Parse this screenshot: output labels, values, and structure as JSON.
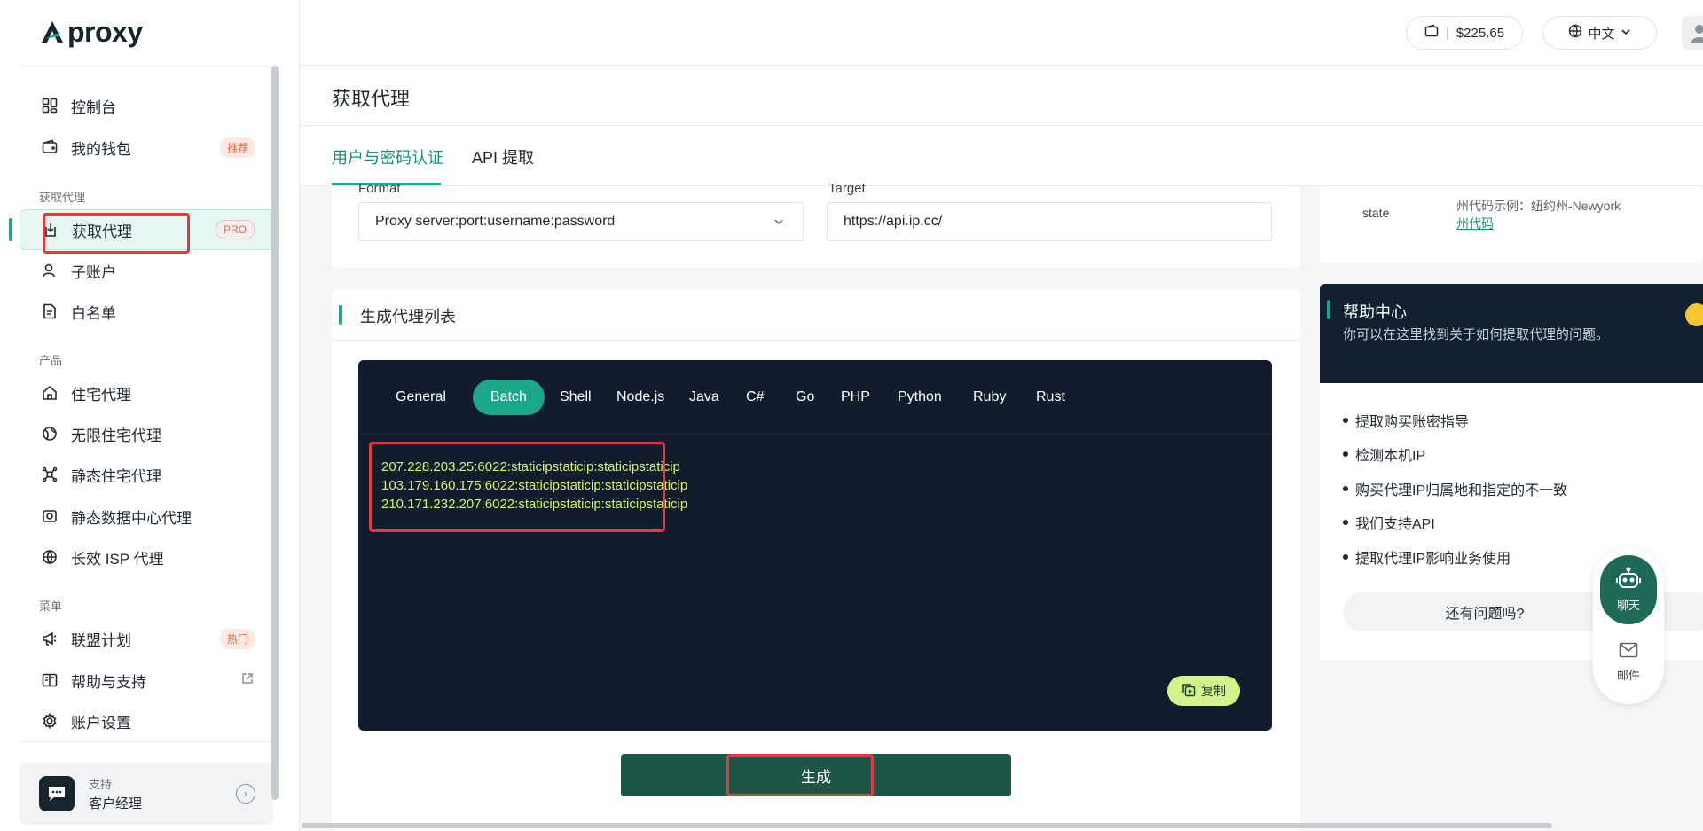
{
  "app": {
    "logo_text": "proxy"
  },
  "sidebar": {
    "sections": {
      "proxy": "获取代理",
      "product": "产品",
      "menu": "菜单"
    },
    "items": [
      {
        "label": "控制台"
      },
      {
        "label": "我的钱包",
        "badge": "推荐"
      },
      {
        "label": "获取代理",
        "badge": "PRO"
      },
      {
        "label": "子账户"
      },
      {
        "label": "白名单"
      },
      {
        "label": "住宅代理"
      },
      {
        "label": "无限住宅代理"
      },
      {
        "label": "静态住宅代理"
      },
      {
        "label": "静态数据中心代理"
      },
      {
        "label": "长效 ISP 代理"
      },
      {
        "label": "联盟计划",
        "badge": "热门"
      },
      {
        "label": "帮助与支持"
      },
      {
        "label": "账户设置"
      }
    ],
    "support": {
      "label": "支持",
      "name": "客户经理"
    }
  },
  "topbar": {
    "balance": "$225.65",
    "language": "中文"
  },
  "page": {
    "title": "获取代理",
    "tabs": [
      "用户与密码认证",
      "API 提取"
    ]
  },
  "form": {
    "format_label": "Format",
    "format_value": "Proxy server:port:username:password",
    "target_label": "Target",
    "target_value": "https://api.ip.cc/"
  },
  "proxy_list": {
    "title": "生成代理列表",
    "code_tabs": [
      "General",
      "Batch",
      "Shell",
      "Node.js",
      "Java",
      "C#",
      "Go",
      "PHP",
      "Python",
      "Ruby",
      "Rust"
    ],
    "active_tab": "Batch",
    "lines": [
      "207.228.203.25:6022:staticipstaticip:staticipstaticip",
      "103.179.160.175:6022:staticipstaticip:staticipstaticip",
      "210.171.232.207:6022:staticipstaticip:staticipstaticip"
    ],
    "copy_label": "复制",
    "generate_label": "生成"
  },
  "state_info": {
    "label": "state",
    "example": "州代码示例：纽约州-Newyork",
    "link": "州代码"
  },
  "help": {
    "title": "帮助中心",
    "desc": "你可以在这里找到关于如何提取代理的问题。",
    "items": [
      "提取购买账密指导",
      "检测本机IP",
      "购买代理IP归属地和指定的不一致",
      "我们支持API",
      "提取代理IP影响业务使用"
    ],
    "more": "还有问题吗?"
  },
  "float": {
    "chat": "聊天",
    "mail": "邮件"
  },
  "colors": {
    "accent": "#1aa88a",
    "dark_panel": "#111d2c",
    "code_text": "#d8f06a",
    "highlight": "#e03a3a"
  }
}
